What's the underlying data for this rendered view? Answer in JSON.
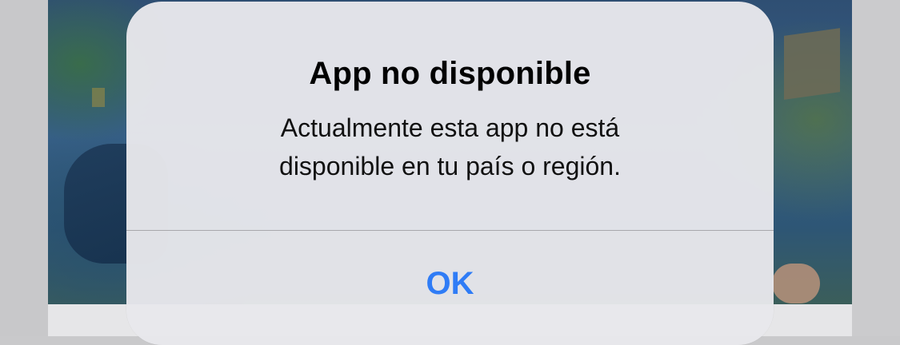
{
  "alert": {
    "title": "App no disponible",
    "message_line1": "Actualmente esta app no está",
    "message_line2": "disponible en tu país o región.",
    "ok_label": "OK"
  },
  "colors": {
    "accent": "#2f7cf6",
    "alert_background": "#e8e8ec",
    "divider": "#a8a8ac"
  }
}
